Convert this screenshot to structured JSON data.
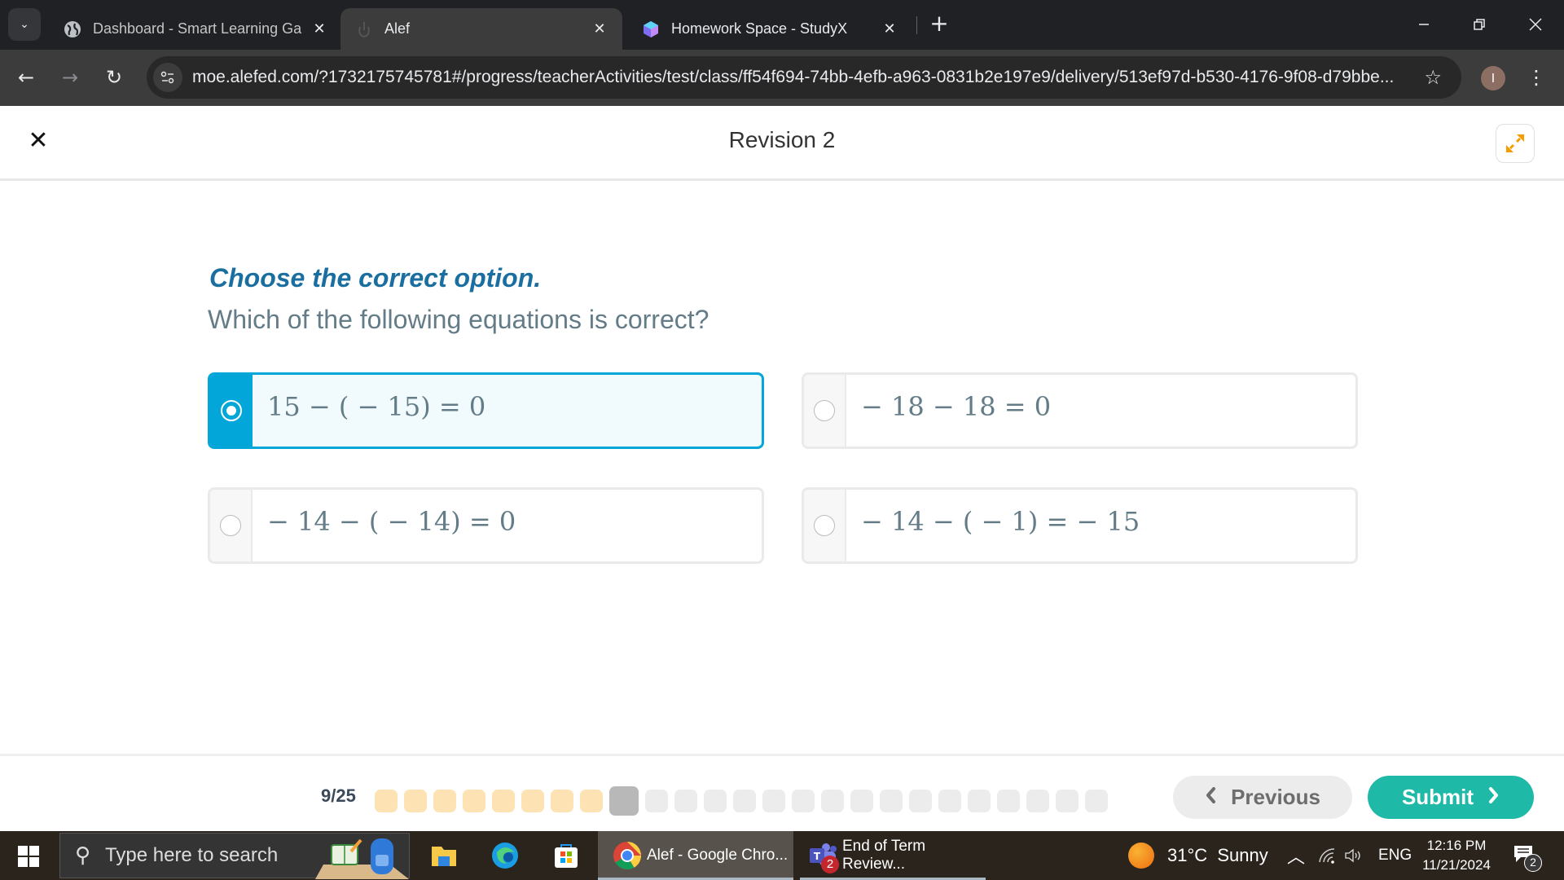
{
  "browser": {
    "tabs": [
      {
        "title": "Dashboard - Smart Learning Ga",
        "icon": "globe-icon",
        "active": false
      },
      {
        "title": "Alef",
        "icon": "alef-icon",
        "active": true
      },
      {
        "title": "Homework Space - StudyX",
        "icon": "studyx-icon",
        "active": false
      }
    ],
    "url": "moe.alefed.com/?1732175745781#/progress/teacherActivities/test/class/ff54f694-74bb-4efb-a963-0831b2e197e9/delivery/513ef97d-b530-4176-9f08-d79bbe...",
    "profile_initial": "I"
  },
  "header": {
    "title": "Revision 2"
  },
  "question": {
    "instruction": "Choose the correct option.",
    "prompt": "Which of the following equations is correct?",
    "options": [
      {
        "text": "15 − ( − 15) = 0",
        "selected": true
      },
      {
        "text": "− 18 − 18 = 0",
        "selected": false
      },
      {
        "text": "− 14 − ( − 14) = 0",
        "selected": false
      },
      {
        "text": "− 14 − ( − 1) = − 15",
        "selected": false
      }
    ]
  },
  "footer": {
    "counter": "9/25",
    "current_question": 9,
    "total_questions": 25,
    "answered_count": 8,
    "previous_label": "Previous",
    "submit_label": "Submit"
  },
  "colors": {
    "accent": "#02a6d8",
    "submit": "#1fb9a8",
    "instruction": "#1a6fa0",
    "expand_icon": "#f59c00",
    "answered_pip": "#fde3b3"
  },
  "taskbar": {
    "search_placeholder": "Type here to search",
    "apps": [
      {
        "label": "Alef - Google Chro...",
        "active": true
      },
      {
        "label": "End of Term Review...",
        "badge": "2",
        "active": false
      }
    ],
    "weather": "31°C  Sunny",
    "language": "ENG",
    "time": "12:16 PM",
    "date": "11/21/2024",
    "notification_count": "2"
  }
}
